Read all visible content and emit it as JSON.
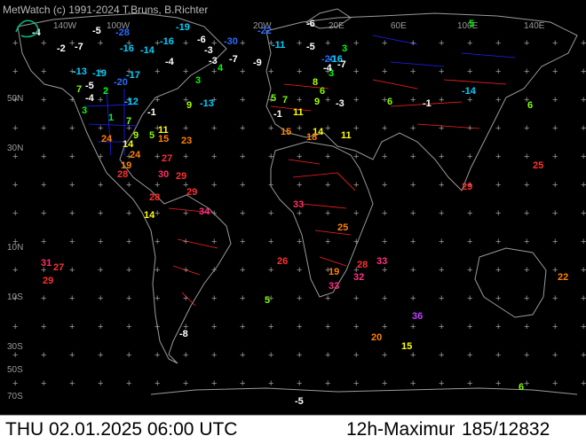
{
  "header": {
    "copyright": "MetWatch  (c) 1991-2024 T.Bruns, B.Richter"
  },
  "status": {
    "datetime": "THU 02.01.2025 06:00 UTC",
    "product": "12h-Maximum",
    "counts": "185/12832"
  },
  "axis_labels": {
    "top": [
      "140W",
      "100W",
      "20W",
      "20E",
      "60E",
      "100E",
      "140E"
    ],
    "left": [
      "50N",
      "30N",
      "10N",
      "10S",
      "30S",
      "50S",
      "70S"
    ]
  },
  "colors": {
    "background": "#000000",
    "land_outline": "#9a9a9a",
    "borders": "#ff2020",
    "us_states": "#2020ff",
    "grid_marks": "#9a9a9a"
  },
  "stations": [
    {
      "v": "-28",
      "c": "#2b6bff"
    },
    {
      "v": "-19",
      "c": "#00d0ff"
    },
    {
      "v": "-5",
      "c": "#ffffff"
    },
    {
      "v": "-6",
      "c": "#ffffff"
    },
    {
      "v": "-30",
      "c": "#2b6bff"
    },
    {
      "v": "-22",
      "c": "#2b6bff"
    },
    {
      "v": "-11",
      "c": "#00d0ff"
    },
    {
      "v": "-6",
      "c": "#ffffff"
    },
    {
      "v": "5",
      "c": "#00ff00"
    },
    {
      "v": "-3",
      "c": "#ffffff"
    },
    {
      "v": "3",
      "c": "#00ff00"
    },
    {
      "v": "-16",
      "c": "#00d0ff"
    },
    {
      "v": "-4",
      "c": "#ffffff"
    },
    {
      "v": "-7",
      "c": "#ffffff"
    },
    {
      "v": "-9",
      "c": "#ffffff"
    },
    {
      "v": "-3",
      "c": "#ffffff"
    },
    {
      "v": "-2",
      "c": "#ffffff"
    },
    {
      "v": "-7",
      "c": "#ffffff"
    },
    {
      "v": "-16",
      "c": "#00d0ff"
    },
    {
      "v": "-14",
      "c": "#00d0ff"
    },
    {
      "v": "-13",
      "c": "#00d0ff"
    },
    {
      "v": "-5",
      "c": "#ffffff"
    },
    {
      "v": "-19",
      "c": "#00d0ff"
    },
    {
      "v": "-20",
      "c": "#2b6bff"
    },
    {
      "v": "-17",
      "c": "#00d0ff"
    },
    {
      "v": "-4",
      "c": "#ffffff"
    },
    {
      "v": "3",
      "c": "#00ff00"
    },
    {
      "v": "-12",
      "c": "#00d0ff"
    },
    {
      "v": "-1",
      "c": "#ffffff"
    },
    {
      "v": "7",
      "c": "#80ff00"
    },
    {
      "v": "2",
      "c": "#00ff00"
    },
    {
      "v": "3",
      "c": "#00ff00"
    },
    {
      "v": "1",
      "c": "#00ff00"
    },
    {
      "v": "7",
      "c": "#80ff00"
    },
    {
      "v": "9",
      "c": "#aaff00"
    },
    {
      "v": "5",
      "c": "#80ff00"
    },
    {
      "v": "11",
      "c": "#ffff00"
    },
    {
      "v": "24",
      "c": "#ff8000"
    },
    {
      "v": "14",
      "c": "#ffff00"
    },
    {
      "v": "15",
      "c": "#ff8000"
    },
    {
      "v": "23",
      "c": "#ff8000"
    },
    {
      "v": "19",
      "c": "#ff8000"
    },
    {
      "v": "24",
      "c": "#ff8000"
    },
    {
      "v": "27",
      "c": "#ff3030"
    },
    {
      "v": "28",
      "c": "#ff3030"
    },
    {
      "v": "30",
      "c": "#ff3060"
    },
    {
      "v": "29",
      "c": "#ff3030"
    },
    {
      "v": "28",
      "c": "#ff3030"
    },
    {
      "v": "29",
      "c": "#ff3030"
    },
    {
      "v": "14",
      "c": "#ffff00"
    },
    {
      "v": "34",
      "c": "#ff3080"
    },
    {
      "v": "31",
      "c": "#ff3060"
    },
    {
      "v": "27",
      "c": "#ff3030"
    },
    {
      "v": "29",
      "c": "#ff3030"
    },
    {
      "v": "-20",
      "c": "#2b6bff"
    },
    {
      "v": "-16",
      "c": "#00d0ff"
    },
    {
      "v": "-5",
      "c": "#ffffff"
    },
    {
      "v": "-7",
      "c": "#ffffff"
    },
    {
      "v": "3",
      "c": "#00ff00"
    },
    {
      "v": "5",
      "c": "#80ff00"
    },
    {
      "v": "7",
      "c": "#80ff00"
    },
    {
      "v": "11",
      "c": "#ffff00"
    },
    {
      "v": "8",
      "c": "#aaff00"
    },
    {
      "v": "6",
      "c": "#80ff00"
    },
    {
      "v": "9",
      "c": "#aaff00"
    },
    {
      "v": "-1",
      "c": "#ffffff"
    },
    {
      "v": "14",
      "c": "#ffff00"
    },
    {
      "v": "15",
      "c": "#ff8000"
    },
    {
      "v": "18",
      "c": "#ff8000"
    },
    {
      "v": "11",
      "c": "#ffff00"
    },
    {
      "v": "6",
      "c": "#80ff00"
    },
    {
      "v": "-1",
      "c": "#ffffff"
    },
    {
      "v": "-14",
      "c": "#00d0ff"
    },
    {
      "v": "6",
      "c": "#80ff00"
    },
    {
      "v": "25",
      "c": "#ff3030"
    },
    {
      "v": "29",
      "c": "#ff3030"
    },
    {
      "v": "33",
      "c": "#ff3060"
    },
    {
      "v": "25",
      "c": "#ff8000"
    },
    {
      "v": "26",
      "c": "#ff3030"
    },
    {
      "v": "19",
      "c": "#ff8000"
    },
    {
      "v": "28",
      "c": "#ff3030"
    },
    {
      "v": "33",
      "c": "#ff3080"
    },
    {
      "v": "32",
      "c": "#ff3080"
    },
    {
      "v": "33",
      "c": "#ff3080"
    },
    {
      "v": "22",
      "c": "#ff8000"
    },
    {
      "v": "36",
      "c": "#c040ff"
    },
    {
      "v": "20",
      "c": "#ff8000"
    },
    {
      "v": "15",
      "c": "#ffff00"
    },
    {
      "v": "5",
      "c": "#80ff00"
    },
    {
      "v": "-8",
      "c": "#ffffff"
    },
    {
      "v": "6",
      "c": "#80ff00"
    },
    {
      "v": "-5",
      "c": "#ffffff"
    },
    {
      "v": "-4",
      "c": "#ffffff"
    },
    {
      "v": "-3",
      "c": "#ffffff"
    },
    {
      "v": "9",
      "c": "#aaff00"
    },
    {
      "v": "4",
      "c": "#00ff00"
    },
    {
      "v": "-13",
      "c": "#00d0ff"
    },
    {
      "v": "-4",
      "c": "#ffffff"
    },
    {
      "v": "3",
      "c": "#00ff00"
    }
  ]
}
